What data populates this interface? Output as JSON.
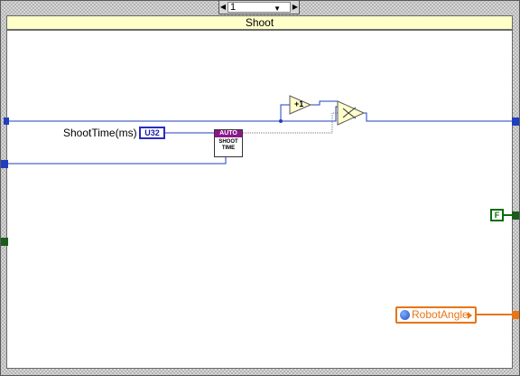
{
  "case_structure": {
    "selector_value": "1",
    "case_label": "Shoot",
    "colors": {
      "header": "#ffffc8",
      "selector": "#d6d6d6",
      "numeric_wire": "#1f3fbf",
      "boolean_wire": "#0b6d0b",
      "dbl_wire": "#e87514"
    }
  },
  "block_diagram": {
    "shoot_time_label": "ShootTime(ms)",
    "u32_type_label": "U32",
    "increment_label": "+1",
    "auto_subvi": {
      "band_label": "AUTO",
      "line1": "SHOOT",
      "line2": "TIME"
    },
    "select_icon": "select-icon",
    "false_constant": "F",
    "robot_angle_label": "RobotAngle"
  }
}
